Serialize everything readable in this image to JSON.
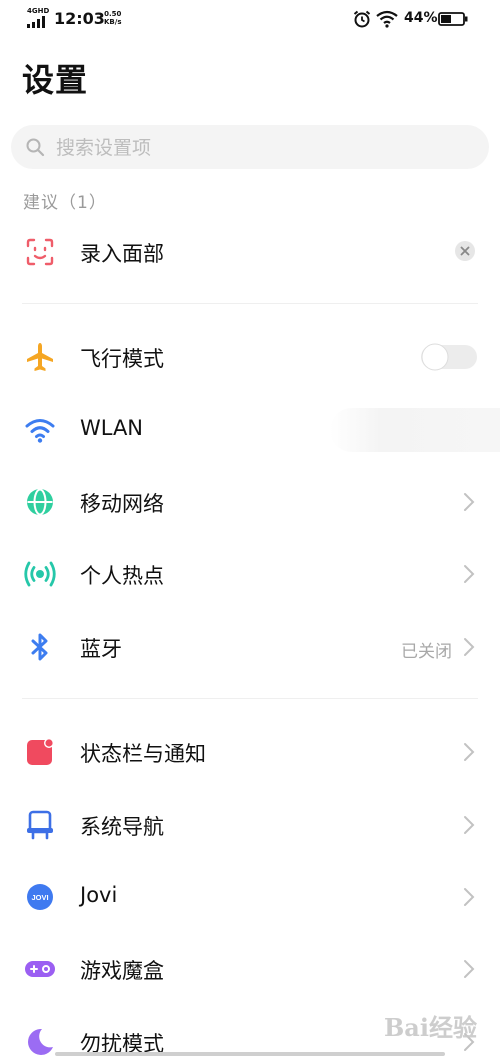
{
  "status_bar": {
    "network_type": "4GHD",
    "time": "12:03",
    "net_speed_value": "0.50",
    "net_speed_unit": "KB/s",
    "battery_percent": "44%"
  },
  "header": {
    "title": "设置"
  },
  "search": {
    "placeholder": "搜索设置项"
  },
  "suggestions": {
    "header": "建议（1）",
    "items": [
      {
        "label": "录入面部",
        "icon": "face-scan-icon"
      }
    ]
  },
  "connectivity": [
    {
      "label": "飞行模式",
      "icon": "airplane-icon",
      "control": "toggle",
      "state": "off"
    },
    {
      "label": "WLAN",
      "icon": "wifi-icon",
      "control": "none"
    },
    {
      "label": "移动网络",
      "icon": "globe-icon",
      "control": "chevron"
    },
    {
      "label": "个人热点",
      "icon": "hotspot-icon",
      "control": "chevron"
    },
    {
      "label": "蓝牙",
      "icon": "bluetooth-icon",
      "control": "chevron",
      "value": "已关闭"
    }
  ],
  "system": [
    {
      "label": "状态栏与通知",
      "icon": "notification-icon"
    },
    {
      "label": "系统导航",
      "icon": "navigation-icon"
    },
    {
      "label": "Jovi",
      "icon": "jovi-icon",
      "icon_text": "JOVI"
    },
    {
      "label": "游戏魔盒",
      "icon": "gamepad-icon"
    },
    {
      "label": "勿扰模式",
      "icon": "moon-icon"
    }
  ],
  "watermark": {
    "text": "Bai经验"
  },
  "colors": {
    "face": "#ef5d6a",
    "airplane": "#f5a623",
    "wifi": "#3d7df0",
    "globe": "#2fcf9f",
    "hotspot": "#25c7a9",
    "bluetooth": "#3d7df0",
    "notification": "#f04a5f",
    "navigation": "#3d6fe6",
    "jovi": "#3f7af0",
    "game": "#9b5ff2",
    "moon": "#9b6cf3"
  }
}
